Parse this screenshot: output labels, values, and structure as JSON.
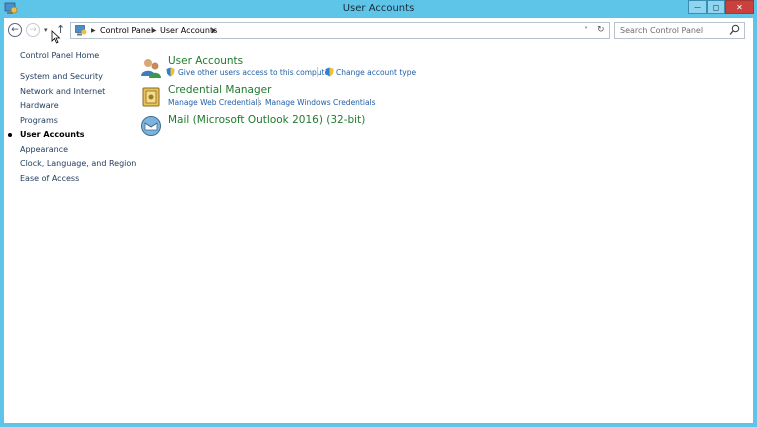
{
  "window": {
    "title": "User Accounts",
    "min_label": "—",
    "max_label": "◻",
    "close_label": "✕"
  },
  "nav": {
    "back_icon": "←",
    "forward_icon": "→",
    "recent_icon": "▾",
    "up_icon": "↑",
    "breadcrumb": [
      "Control Panel",
      "User Accounts"
    ],
    "crumb_separator": "▶",
    "dropdown_icon": "˅",
    "refresh_icon": "↻",
    "search_placeholder": "Search Control Panel"
  },
  "sidebar": {
    "items": [
      "Control Panel Home",
      "System and Security",
      "Network and Internet",
      "Hardware",
      "Programs",
      "User Accounts",
      "Appearance",
      "Clock, Language, and Region",
      "Ease of Access"
    ],
    "active_index": 5
  },
  "categories": [
    {
      "title": "User Accounts",
      "icon": "users-icon",
      "links": [
        "Give other users access to this computer",
        "Change account type"
      ]
    },
    {
      "title": "Credential Manager",
      "icon": "vault-icon",
      "links": [
        "Manage Web Credentials",
        "Manage Windows Credentials"
      ]
    },
    {
      "title": "Mail (Microsoft Outlook 2016) (32-bit)",
      "icon": "mail-icon",
      "links": []
    }
  ],
  "colors": {
    "title_bar": "#5ec4e8",
    "category_title": "#1f7a2c",
    "link": "#1f5fa8",
    "sidebar_link": "#1e395b",
    "close_button": "#c8413c"
  }
}
